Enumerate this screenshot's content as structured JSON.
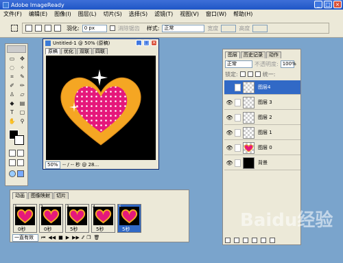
{
  "app": {
    "title": "Adobe ImageReady"
  },
  "menu": [
    "文件(F)",
    "编辑(E)",
    "图像(I)",
    "图层(L)",
    "切片(S)",
    "选择(S)",
    "滤镜(T)",
    "视图(V)",
    "窗口(W)",
    "帮助(H)"
  ],
  "options": {
    "feather_label": "羽化:",
    "feather_value": "0 px",
    "antialias_label": "消除锯齿",
    "style_label": "样式:",
    "style_value": "正常",
    "width_label": "宽度",
    "height_label": "高度"
  },
  "document": {
    "title": "Untitled-1 @ 50% (原稿)",
    "tabs": [
      "原稿",
      "优化",
      "双联",
      "四联"
    ],
    "zoom": "50%",
    "status_mid": "-- / -- 秒 @ 28...",
    "heart_colors": {
      "outer": "#f5a623",
      "inner": "#e5187b",
      "dots": "#ffffff"
    }
  },
  "layers_panel": {
    "tabs": [
      "图层",
      "历史记录",
      "动作"
    ],
    "blend_mode": "正常",
    "opacity_label": "不透明度:",
    "opacity_value": "100%",
    "lock_label": "锁定:",
    "unify_label": "统一:",
    "rows": [
      {
        "name": "图层4",
        "selected": true,
        "visible": false
      },
      {
        "name": "图层 3",
        "selected": false,
        "visible": true
      },
      {
        "name": "图层 2",
        "selected": false,
        "visible": true
      },
      {
        "name": "图层 1",
        "selected": false,
        "visible": true
      },
      {
        "name": "图层 0",
        "selected": false,
        "visible": true
      },
      {
        "name": "背景",
        "selected": false,
        "visible": true
      }
    ]
  },
  "animation": {
    "tabs": [
      "动画",
      "图像映射",
      "切片"
    ],
    "frames": [
      {
        "num": "1",
        "delay": "0秒"
      },
      {
        "num": "2",
        "delay": "0秒"
      },
      {
        "num": "3",
        "delay": "5秒"
      },
      {
        "num": "4",
        "delay": "5秒"
      },
      {
        "num": "5",
        "delay": "5秒",
        "selected": true
      }
    ],
    "loop": "一直有效"
  },
  "watermark": "Baidu经验"
}
